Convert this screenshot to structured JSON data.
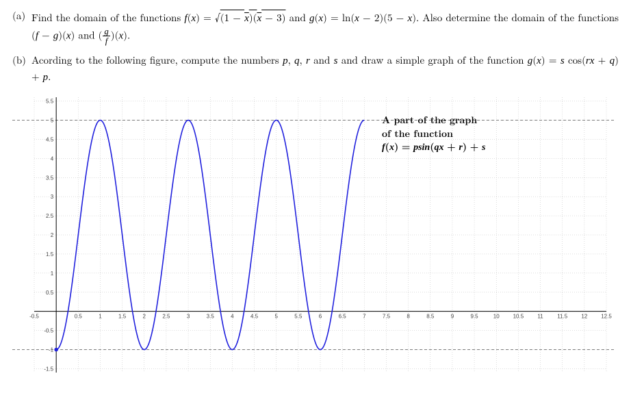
{
  "problem_a": {
    "label": "(a)",
    "text_pre": "Find the domain of the functions ",
    "f_expr": "f(x) = √((1 − x)(x − 3))",
    "mid1": " and ",
    "g_expr": "g(x) = ln(x − 2)(5 − x)",
    "text_post1": ". Also determine the domain of the functions ",
    "fg1": "(f − g)(x)",
    "mid2": " and ",
    "fg2": "(g/f)(x)",
    "text_post2": "."
  },
  "problem_b": {
    "label": "(b)",
    "text_pre": "Acording to the following figure, compute the numbers ",
    "vars": "p, q, r",
    "mid1": " and ",
    "var_s": "s",
    "text_mid": " and draw a simple graph of the function ",
    "g_expr": "g(x) = s cos(rx + q) + p",
    "text_post": "."
  },
  "legend": {
    "title": "A part of the graph",
    "title2": "of the function",
    "func": "f(x) = psin(qx + r) + s"
  },
  "chart_data": {
    "type": "line",
    "title": "",
    "xlabel": "",
    "ylabel": "",
    "xlim": [
      -0.5,
      12.5
    ],
    "ylim": [
      -1.6,
      5.6
    ],
    "x_ticks": [
      -0.5,
      0,
      0.5,
      1,
      1.5,
      2,
      2.5,
      3,
      3.5,
      4,
      4.5,
      5,
      5.5,
      6,
      6.5,
      7,
      7.5,
      8,
      8.5,
      9,
      9.5,
      10,
      10.5,
      11,
      11.5,
      12,
      12.5
    ],
    "y_ticks": [
      -1.5,
      -1,
      -0.5,
      0,
      0.5,
      1,
      1.5,
      2,
      2.5,
      3,
      3.5,
      4,
      4.5,
      5,
      5.5
    ],
    "dashed_y_lines": [
      -1,
      5
    ],
    "curve": {
      "formula": "f(x) = 3*sin(pi*x - pi/2) + 2",
      "params": {
        "p": 3,
        "q": 3.14159265,
        "r": -1.5708,
        "s": 2
      },
      "domain": [
        0,
        7
      ],
      "key_points": [
        {
          "x": 0,
          "y": -1
        },
        {
          "x": 1,
          "y": 5
        },
        {
          "x": 2,
          "y": -1
        },
        {
          "x": 3,
          "y": 5
        },
        {
          "x": 4,
          "y": -1
        },
        {
          "x": 5,
          "y": 5
        },
        {
          "x": 6,
          "y": -1
        },
        {
          "x": 7,
          "y": 5
        }
      ]
    },
    "grid": true
  }
}
